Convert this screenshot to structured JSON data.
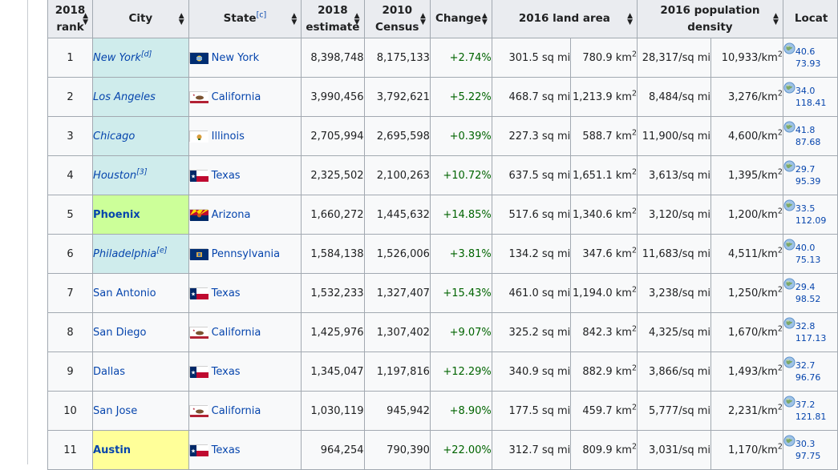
{
  "table": {
    "headers": {
      "rank": [
        "2018",
        "rank"
      ],
      "city": "City",
      "state": "State",
      "state_note": "[c]",
      "estimate": [
        "2018",
        "estimate"
      ],
      "census": [
        "2010",
        "Census"
      ],
      "change": "Change",
      "land_area": "2016 land area",
      "density": [
        "2016 population",
        "density"
      ],
      "location": "Locat"
    },
    "rows": [
      {
        "rank": "1",
        "city": "New York",
        "city_note": "[d]",
        "city_style": "blue",
        "state": "New York",
        "flag": "new-york-flag",
        "estimate": "8,398,748",
        "census": "8,175,133",
        "change": "+2.74%",
        "area_mi": "301.5 sq mi",
        "area_km_num": "780.9 km",
        "density_mi": "28,317/sq mi",
        "density_km_num": "10,933/km",
        "lat": "40.6",
        "lon": "73.93"
      },
      {
        "rank": "2",
        "city": "Los Angeles",
        "city_note": "",
        "city_style": "blue",
        "state": "California",
        "flag": "california-flag",
        "estimate": "3,990,456",
        "census": "3,792,621",
        "change": "+5.22%",
        "area_mi": "468.7 sq mi",
        "area_km_num": "1,213.9 km",
        "density_mi": "8,484/sq mi",
        "density_km_num": "3,276/km",
        "lat": "34.0",
        "lon": "118.41"
      },
      {
        "rank": "3",
        "city": "Chicago",
        "city_note": "",
        "city_style": "blue",
        "state": "Illinois",
        "flag": "illinois-flag",
        "estimate": "2,705,994",
        "census": "2,695,598",
        "change": "+0.39%",
        "area_mi": "227.3 sq mi",
        "area_km_num": "588.7 km",
        "density_mi": "11,900/sq mi",
        "density_km_num": "4,600/km",
        "lat": "41.8",
        "lon": "87.68"
      },
      {
        "rank": "4",
        "city": "Houston",
        "city_note": "[3]",
        "city_style": "blue",
        "state": "Texas",
        "flag": "texas-flag",
        "estimate": "2,325,502",
        "census": "2,100,263",
        "change": "+10.72%",
        "area_mi": "637.5 sq mi",
        "area_km_num": "1,651.1 km",
        "density_mi": "3,613/sq mi",
        "density_km_num": "1,395/km",
        "lat": "29.7",
        "lon": "95.39"
      },
      {
        "rank": "5",
        "city": "Phoenix",
        "city_note": "",
        "city_style": "green",
        "state": "Arizona",
        "flag": "arizona-flag",
        "estimate": "1,660,272",
        "census": "1,445,632",
        "change": "+14.85%",
        "area_mi": "517.6 sq mi",
        "area_km_num": "1,340.6 km",
        "density_mi": "3,120/sq mi",
        "density_km_num": "1,200/km",
        "lat": "33.5",
        "lon": "112.09"
      },
      {
        "rank": "6",
        "city": "Philadelphia",
        "city_note": "[e]",
        "city_style": "blue",
        "state": "Pennsylvania",
        "flag": "pennsylvania-flag",
        "estimate": "1,584,138",
        "census": "1,526,006",
        "change": "+3.81%",
        "area_mi": "134.2 sq mi",
        "area_km_num": "347.6 km",
        "density_mi": "11,683/sq mi",
        "density_km_num": "4,511/km",
        "lat": "40.0",
        "lon": "75.13"
      },
      {
        "rank": "7",
        "city": "San Antonio",
        "city_note": "",
        "city_style": "plain",
        "state": "Texas",
        "flag": "texas-flag",
        "estimate": "1,532,233",
        "census": "1,327,407",
        "change": "+15.43%",
        "area_mi": "461.0 sq mi",
        "area_km_num": "1,194.0 km",
        "density_mi": "3,238/sq mi",
        "density_km_num": "1,250/km",
        "lat": "29.4",
        "lon": "98.52"
      },
      {
        "rank": "8",
        "city": "San Diego",
        "city_note": "",
        "city_style": "plain",
        "state": "California",
        "flag": "california-flag",
        "estimate": "1,425,976",
        "census": "1,307,402",
        "change": "+9.07%",
        "area_mi": "325.2 sq mi",
        "area_km_num": "842.3 km",
        "density_mi": "4,325/sq mi",
        "density_km_num": "1,670/km",
        "lat": "32.8",
        "lon": "117.13"
      },
      {
        "rank": "9",
        "city": "Dallas",
        "city_note": "",
        "city_style": "plain",
        "state": "Texas",
        "flag": "texas-flag",
        "estimate": "1,345,047",
        "census": "1,197,816",
        "change": "+12.29%",
        "area_mi": "340.9 sq mi",
        "area_km_num": "882.9 km",
        "density_mi": "3,866/sq mi",
        "density_km_num": "1,493/km",
        "lat": "32.7",
        "lon": "96.76"
      },
      {
        "rank": "10",
        "city": "San Jose",
        "city_note": "",
        "city_style": "plain",
        "state": "California",
        "flag": "california-flag",
        "estimate": "1,030,119",
        "census": "945,942",
        "change": "+8.90%",
        "area_mi": "177.5 sq mi",
        "area_km_num": "459.7 km",
        "density_mi": "5,777/sq mi",
        "density_km_num": "2,231/km",
        "lat": "37.2",
        "lon": "121.81"
      },
      {
        "rank": "11",
        "city": "Austin",
        "city_note": "",
        "city_style": "yellow",
        "state": "Texas",
        "flag": "texas-flag",
        "estimate": "964,254",
        "census": "790,390",
        "change": "+22.00%",
        "area_mi": "312.7 sq mi",
        "area_km_num": "809.9 km",
        "density_mi": "3,031/sq mi",
        "density_km_num": "1,170/km",
        "lat": "30.3",
        "lon": "97.75"
      }
    ],
    "superscript_2": "2"
  },
  "colors": {
    "link": "#0645ad",
    "change_positive": "#006400",
    "row_highlight_blue": "#cfecec",
    "row_highlight_green": "#ccff99",
    "row_highlight_yellow": "#ffff99"
  }
}
